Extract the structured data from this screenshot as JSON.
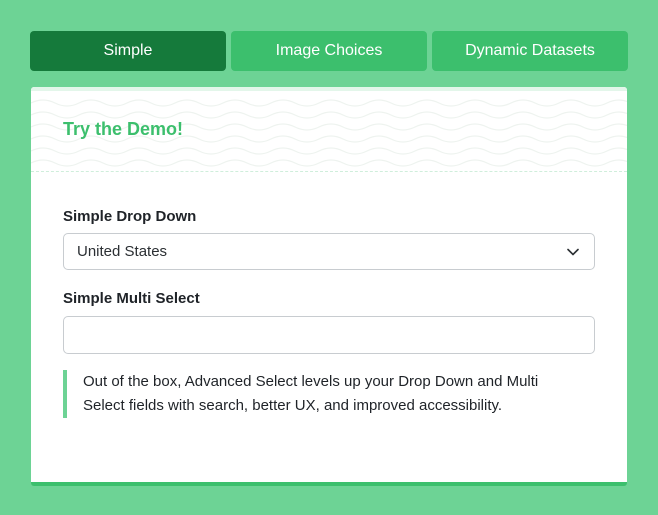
{
  "tabs": [
    {
      "label": "Simple",
      "active": true
    },
    {
      "label": "Image Choices",
      "active": false
    },
    {
      "label": "Dynamic Datasets",
      "active": false
    }
  ],
  "card": {
    "title": "Try the Demo!",
    "dropdown": {
      "label": "Simple Drop Down",
      "value": "United States",
      "icon": "chevron-down-icon"
    },
    "multi_select": {
      "label": "Simple Multi Select",
      "value": ""
    },
    "note": "Out of the box, Advanced Select levels up your Drop Down and Multi Select fields with search, better UX, and improved accessibility."
  },
  "colors": {
    "page_background": "#6dd395",
    "tab_active": "#157a3b",
    "tab_inactive": "#3cbf6d",
    "title_green": "#3cbf6d",
    "note_border": "#6dd395"
  }
}
